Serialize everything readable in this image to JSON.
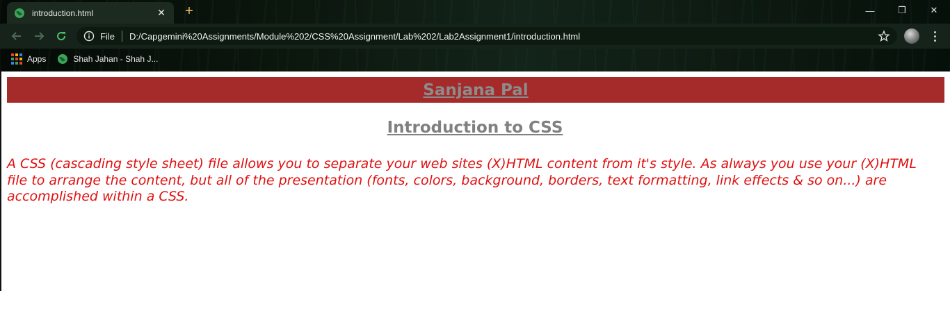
{
  "browser": {
    "tab": {
      "title": "introduction.html",
      "close_glyph": "✕",
      "favicon": "globe-icon"
    },
    "new_tab_glyph": "+",
    "window_controls": {
      "minimize": "—",
      "restore": "❐",
      "close": "✕"
    },
    "address_bar": {
      "scheme_label": "File",
      "url": "D:/Capgemini%20Assignments/Module%202/CSS%20Assignment/Lab%202/Lab2Assignment1/introduction.html"
    },
    "bookmarks": [
      {
        "label": "Apps",
        "icon": "apps-grid-icon"
      },
      {
        "label": "Shah Jahan - Shah J...",
        "icon": "globe-icon"
      }
    ]
  },
  "page": {
    "banner_title": "Sanjana Pal",
    "heading": "Introduction to CSS",
    "paragraph": "A CSS (cascading style sheet) file allows you to separate your web sites (X)HTML content from it's style. As always you use your (X)HTML file to arrange the content, but all of the presentation (fonts, colors, background, borders, text formatting, link effects & so on...) are accomplished within a CSS."
  },
  "colors": {
    "banner_bg": "#a52a2a",
    "title_text": "#8c8c8c",
    "heading_text": "#808080",
    "paragraph_text": "#e01010",
    "favicon_green": "#3aa55a"
  }
}
